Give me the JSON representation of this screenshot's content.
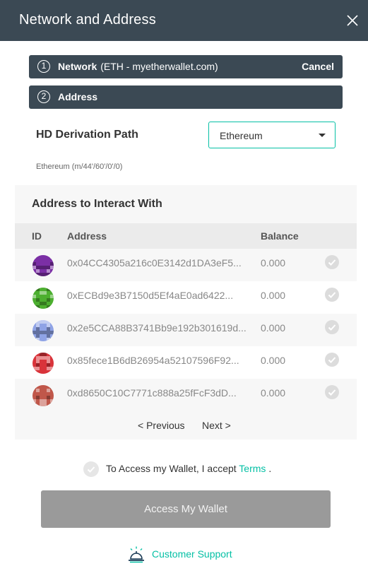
{
  "header": {
    "title": "Network and Address"
  },
  "steps": [
    {
      "number": "1",
      "label": "Network",
      "sub": "(ETH - myetherwallet.com)",
      "action": "Cancel"
    },
    {
      "number": "2",
      "label": "Address"
    }
  ],
  "hd": {
    "title": "HD Derivation Path",
    "selected": "Ethereum",
    "path": "Ethereum (m/44'/60'/0'/0)"
  },
  "address_panel": {
    "title": "Address to Interact With",
    "columns": {
      "id": "ID",
      "address": "Address",
      "balance": "Balance"
    },
    "rows": [
      {
        "address": "0x04CC4305a216c0E3142d1DA3eF5...",
        "balance": "0.000",
        "avatar_color": "#7b2fa5"
      },
      {
        "address": "0xECBd9e3B7150d5Ef4aE0ad6422...",
        "balance": "0.000",
        "avatar_color": "#4caf2f"
      },
      {
        "address": "0x2e5CCA88B3741Bb9e192b301619d...",
        "balance": "0.000",
        "avatar_color": "#8fa3e6"
      },
      {
        "address": "0x85fece1B6dB26954a52107596F92...",
        "balance": "0.000",
        "avatar_color": "#d9333a"
      },
      {
        "address": "0xd8650C10C7771c888a25fFcF3dD...",
        "balance": "0.000",
        "avatar_color": "#c0574a"
      }
    ],
    "prev": "< Previous",
    "next": "Next >"
  },
  "accept": {
    "text": "To Access my Wallet, I accept",
    "terms": "Terms",
    "suffix": "."
  },
  "access_button": "Access My Wallet",
  "support": "Customer Support",
  "colors": {
    "header_bg": "#3b4954",
    "accent": "#05c0a5",
    "button_disabled": "#9a9a9a"
  }
}
